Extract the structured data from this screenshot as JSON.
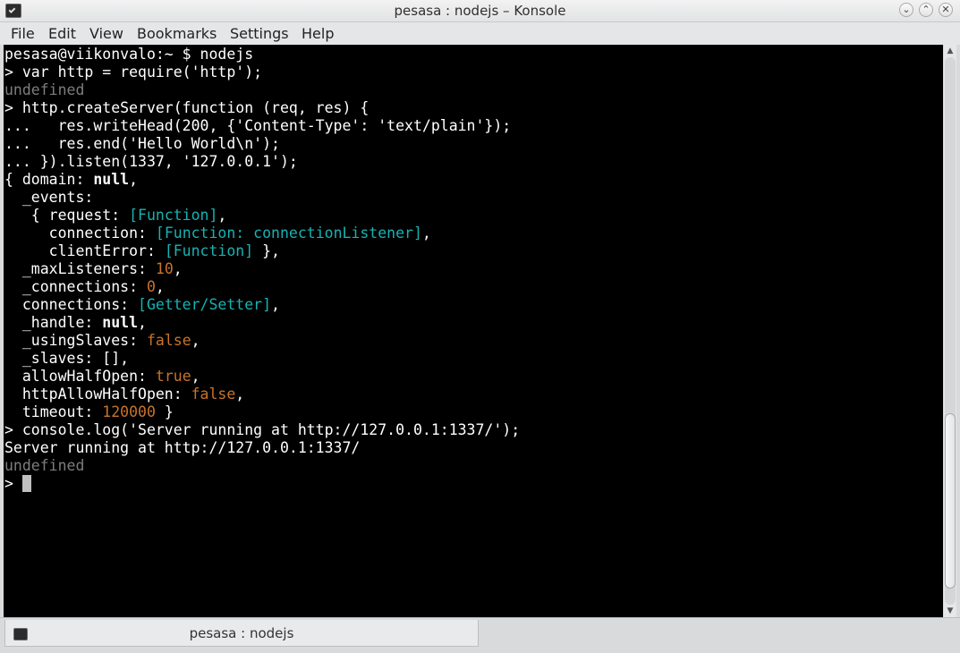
{
  "window": {
    "title": "pesasa : nodejs – Konsole",
    "app_icon": "terminal-icon",
    "controls": {
      "minimize": "⌄",
      "maximize": "⌃",
      "close": "✕"
    }
  },
  "menu": {
    "items": [
      "File",
      "Edit",
      "View",
      "Bookmarks",
      "Settings",
      "Help"
    ]
  },
  "terminal": {
    "colors": {
      "background": "#000000",
      "default": "#ffffff",
      "dim": "#7d7d7d",
      "cyan": "#18b2b2",
      "orange": "#c8742a"
    },
    "lines": [
      [
        {
          "t": "pesasa@viikonvalo:~ $ nodejs"
        }
      ],
      [
        {
          "t": "> var http = require('http');"
        }
      ],
      [
        {
          "t": "undefined",
          "c": "g"
        }
      ],
      [
        {
          "t": "> http.createServer(function (req, res) {"
        }
      ],
      [
        {
          "t": "...   res.writeHead(200, {'Content-Type': 'text/plain'});"
        }
      ],
      [
        {
          "t": "...   res.end('Hello World\\n');"
        }
      ],
      [
        {
          "t": "... }).listen(1337, '127.0.0.1');"
        }
      ],
      [
        {
          "t": "{ domain: "
        },
        {
          "t": "null",
          "c": "b"
        },
        {
          "t": ","
        }
      ],
      [
        {
          "t": "  _events:"
        }
      ],
      [
        {
          "t": "   { request: "
        },
        {
          "t": "[Function]",
          "c": "c"
        },
        {
          "t": ","
        }
      ],
      [
        {
          "t": "     connection: "
        },
        {
          "t": "[Function: connectionListener]",
          "c": "c"
        },
        {
          "t": ","
        }
      ],
      [
        {
          "t": "     clientError: "
        },
        {
          "t": "[Function]",
          "c": "c"
        },
        {
          "t": " },"
        }
      ],
      [
        {
          "t": "  _maxListeners: "
        },
        {
          "t": "10",
          "c": "o"
        },
        {
          "t": ","
        }
      ],
      [
        {
          "t": "  _connections: "
        },
        {
          "t": "0",
          "c": "o"
        },
        {
          "t": ","
        }
      ],
      [
        {
          "t": "  connections: "
        },
        {
          "t": "[Getter/Setter]",
          "c": "c"
        },
        {
          "t": ","
        }
      ],
      [
        {
          "t": "  _handle: "
        },
        {
          "t": "null",
          "c": "b"
        },
        {
          "t": ","
        }
      ],
      [
        {
          "t": "  _usingSlaves: "
        },
        {
          "t": "false",
          "c": "o"
        },
        {
          "t": ","
        }
      ],
      [
        {
          "t": "  _slaves: [],"
        }
      ],
      [
        {
          "t": "  allowHalfOpen: "
        },
        {
          "t": "true",
          "c": "o"
        },
        {
          "t": ","
        }
      ],
      [
        {
          "t": "  httpAllowHalfOpen: "
        },
        {
          "t": "false",
          "c": "o"
        },
        {
          "t": ","
        }
      ],
      [
        {
          "t": "  timeout: "
        },
        {
          "t": "120000",
          "c": "o"
        },
        {
          "t": " }"
        }
      ],
      [
        {
          "t": "> console.log('Server running at http://127.0.0.1:1337/');"
        }
      ],
      [
        {
          "t": "Server running at http://127.0.0.1:1337/"
        }
      ],
      [
        {
          "t": "undefined",
          "c": "g"
        }
      ],
      [
        {
          "t": "> "
        }
      ]
    ]
  },
  "scrollbar": {
    "up_icon": "▲",
    "down_icon": "▼",
    "position_fraction": 1.0
  },
  "tabs": [
    {
      "label": "pesasa : nodejs",
      "icon": "terminal-icon"
    }
  ]
}
